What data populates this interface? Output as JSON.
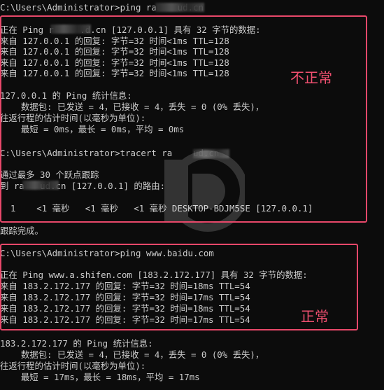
{
  "terminal": {
    "lines": [
      "C:\\Users\\Administrator>ping ra    ud.cn",
      "",
      "正在 Ping r     .d.cn [127.0.0.1] 具有 32 字节的数据:",
      "来自 127.0.0.1 的回复: 字节=32 时间<1ms TTL=128",
      "来自 127.0.0.1 的回复: 字节=32 时间<1ms TTL=128",
      "来自 127.0.0.1 的回复: 字节=32 时间<1ms TTL=128",
      "来自 127.0.0.1 的回复: 字节=32 时间<1ms TTL=128",
      "",
      "127.0.0.1 的 Ping 统计信息:",
      "    数据包: 已发送 = 4，已接收 = 4，丢失 = 0 (0% 丢失)，",
      "往返行程的估计时间(以毫秒为单位):",
      "    最短 = 0ms，最长 = 0ms，平均 = 0ms",
      "",
      "C:\\Users\\Administrator>tracert ra    ud.cn",
      "",
      "通过最多 30 个跃点跟踪",
      "到 ra   ud.cn [127.0.0.1] 的路由:",
      "",
      "  1    <1 毫秒   <1 毫秒   <1 毫秒 DESKTOP-BDJM5SE [127.0.0.1]",
      "",
      "跟踪完成。",
      "",
      "C:\\Users\\Administrator>ping www.baidu.com",
      "",
      "正在 Ping www.a.shifen.com [183.2.172.177] 具有 32 字节的数据:",
      "来自 183.2.172.177 的回复: 字节=32 时间=18ms TTL=54",
      "来自 183.2.172.177 的回复: 字节=32 时间=17ms TTL=54",
      "来自 183.2.172.177 的回复: 字节=32 时间=18ms TTL=54",
      "来自 183.2.172.177 的回复: 字节=32 时间=17ms TTL=54",
      "",
      "183.2.172.177 的 Ping 统计信息:",
      "    数据包: 已发送 = 4，已接收 = 4，丢失 = 0 (0% 丢失)，",
      "往返行程的估计时间(以毫秒为单位):",
      "    最短 = 17ms，最长 = 18ms，平均 = 17ms"
    ]
  },
  "annotations": {
    "abnormal_label": "不正常",
    "normal_label": "正常"
  },
  "colors": {
    "background": "#0c0c0c",
    "text": "#cccccc",
    "highlight": "#e8486a"
  }
}
